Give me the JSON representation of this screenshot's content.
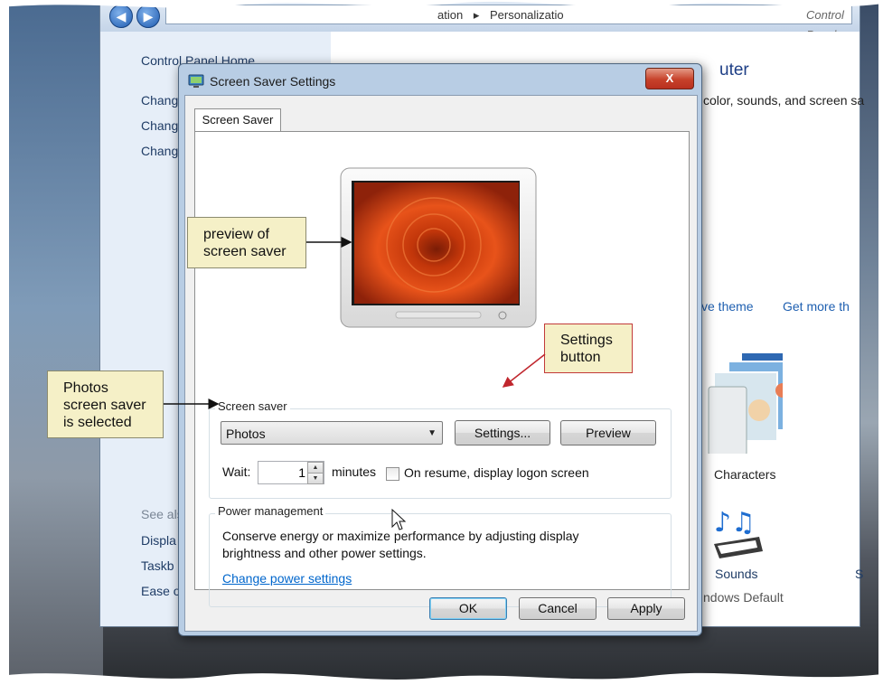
{
  "control_panel": {
    "breadcrumb": {
      "prefix": "ation",
      "separator": "▸",
      "current": "Personalizatio",
      "search_placeholder": "Control Panel"
    },
    "nav": {
      "back": "◀",
      "forward": "▶"
    },
    "left_pane": {
      "home": "Control Panel Home",
      "links": [
        "Chang",
        "Chang",
        "Chang"
      ],
      "see_also": "See als",
      "see_also_links": [
        "Displa",
        "Taskb",
        "Ease o"
      ]
    },
    "main": {
      "title": "Change the visuals and sounds on your computer",
      "title_visible": "uter",
      "subtitle": "color, sounds, and screen sa",
      "theme_links": [
        "ve theme",
        "Get more th"
      ],
      "theme_name": "Characters",
      "sounds_label": "Sounds",
      "sounds_sub": "ndows Default",
      "extra": "S"
    }
  },
  "dialog": {
    "title": "Screen Saver Settings",
    "close_label": "X",
    "tab_label": "Screen Saver",
    "screen_saver": {
      "group_label": "Screen saver",
      "selected": "Photos",
      "settings_button": "Settings...",
      "preview_button": "Preview",
      "wait_label": "Wait:",
      "wait_value": "1",
      "minutes_label": "minutes",
      "resume_checkbox_label": "On resume, display logon screen",
      "resume_checked": false
    },
    "power": {
      "group_label": "Power management",
      "text_line1": "Conserve energy or maximize performance by adjusting display",
      "text_line2": "brightness and other power settings.",
      "link": "Change power settings"
    },
    "buttons": {
      "ok": "OK",
      "cancel": "Cancel",
      "apply": "Apply"
    }
  },
  "callouts": {
    "preview": [
      "preview of",
      "screen saver"
    ],
    "settings": [
      "Settings",
      "button"
    ],
    "photos": [
      "Photos",
      "screen saver",
      "is selected"
    ]
  },
  "colors": {
    "callout_bg": "#f5f0c7",
    "callout_arrow_red": "#c0262d",
    "link_blue": "#0066cc",
    "close_red": "#c7412a",
    "photo_orange": "#e04a12"
  }
}
